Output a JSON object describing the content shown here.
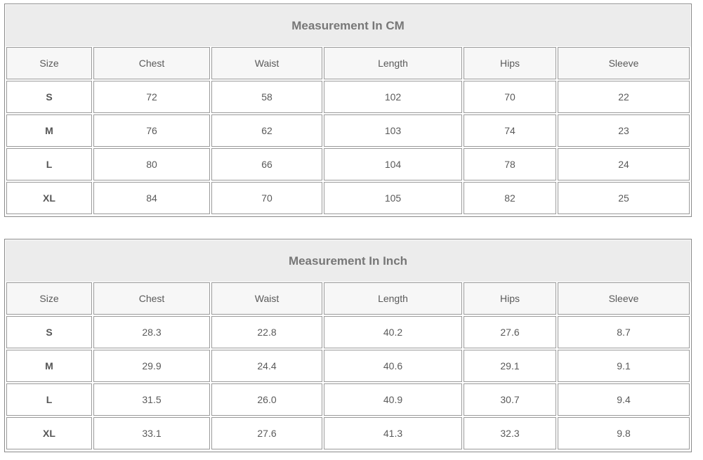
{
  "columns": [
    "Size",
    "Chest",
    "Waist",
    "Length",
    "Hips",
    "Sleeve"
  ],
  "tables": [
    {
      "title": "Measurement In CM",
      "rows": [
        [
          "S",
          "72",
          "58",
          "102",
          "70",
          "22"
        ],
        [
          "M",
          "76",
          "62",
          "103",
          "74",
          "23"
        ],
        [
          "L",
          "80",
          "66",
          "104",
          "78",
          "24"
        ],
        [
          "XL",
          "84",
          "70",
          "105",
          "82",
          "25"
        ]
      ]
    },
    {
      "title": "Measurement In Inch",
      "rows": [
        [
          "S",
          "28.3",
          "22.8",
          "40.2",
          "27.6",
          "8.7"
        ],
        [
          "M",
          "29.9",
          "24.4",
          "40.6",
          "29.1",
          "9.1"
        ],
        [
          "L",
          "31.5",
          "26.0",
          "40.9",
          "30.7",
          "9.4"
        ],
        [
          "XL",
          "33.1",
          "27.6",
          "41.3",
          "32.3",
          "9.8"
        ]
      ]
    }
  ]
}
